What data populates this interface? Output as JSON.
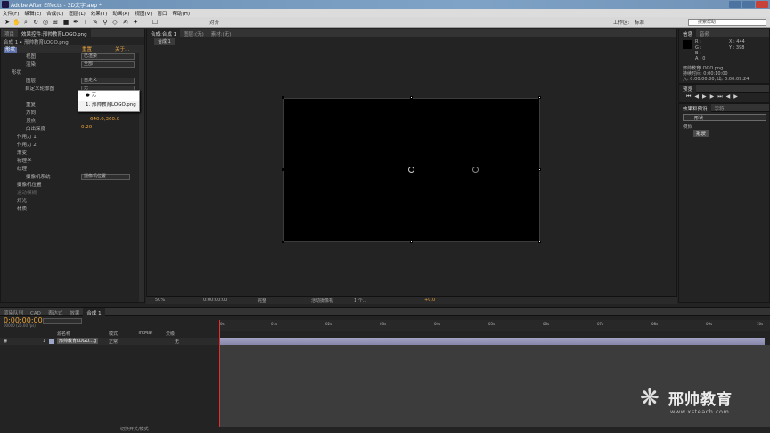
{
  "window": {
    "title": "Adobe After Effects - 3D文字.aep *"
  },
  "menu": [
    "文件(F)",
    "编辑(E)",
    "合成(C)",
    "图层(L)",
    "效果(T)",
    "动画(A)",
    "视图(V)",
    "窗口",
    "帮助(H)"
  ],
  "toolbar": {
    "align_label": "对齐",
    "workspace_label": "工作区:",
    "workspace_value": "标准",
    "search_placeholder": "搜索帮助"
  },
  "fx_panel": {
    "tab_project": "项目",
    "tab_fx": "效果控件:邢帅教育LOGO.png",
    "subtitle": "合成 1 • 邢帅教育LOGO.png",
    "effect_name": "形状",
    "reset_label": "重置",
    "about_label": "关于...",
    "view_label": "视图",
    "view_value": "已渲染",
    "render_label": "渲染",
    "render_value": "全部",
    "shape_group": "形状",
    "layer_label": "图层",
    "layer_value": "自定义",
    "custom_label": "自定义轮廓图",
    "custom_value": "无",
    "repeat_label": "重复",
    "direction_label": "方向",
    "vertex_label": "顶点",
    "vertex_value": "640.0,360.0",
    "bevel_label": "凸出深度",
    "bevel_value": "0.20",
    "groups": [
      "作用力 1",
      "作用力 2",
      "渐变",
      "物理学",
      "纹理"
    ],
    "camera_system_label": "摄像机系统",
    "camera_system_value": "摄像机位置",
    "camera_position": "摄像机位置",
    "motion_blur": "运动模糊",
    "lights": "灯光",
    "material": "材质",
    "popup": {
      "none": "无",
      "item": "1. 邢帅教育LOGO.png"
    }
  },
  "comp": {
    "tab": "合成:合成 1",
    "layer_tab": "图层:(无)",
    "footage_tab": "素材:(无)",
    "breadcrumb": "合成 1",
    "zoom": "50%",
    "timecode": "0:00:00:00",
    "quality": "完整",
    "camera": "活动摄像机",
    "views": "1 个...",
    "exposure": "+0.0"
  },
  "info": {
    "tab_info": "信息",
    "tab_audio": "音频",
    "r": "R :",
    "g": "G :",
    "b": "B :",
    "a": "A : 0",
    "x": "X : 444",
    "y": "Y : 398",
    "file": "邢帅教育LOGO.png",
    "duration": "持续时间: 0:00:10:00",
    "inout": "入: 0:00:00:00, 出: 0:00:09:24"
  },
  "preview": {
    "tab": "预览"
  },
  "effects": {
    "tab": "效果和预设",
    "tab2": "字符",
    "search": "形状",
    "category": "模拟",
    "item": "形状"
  },
  "timeline": {
    "tabs": [
      "渲染队列",
      "CAD",
      "表达式",
      "效果",
      "合成 1"
    ],
    "timecode": "0:00:00:00",
    "fps": "00000 (25.00 fps)",
    "col_name": "源名称",
    "col_mode": "模式",
    "col_trk": "T TrkMat",
    "col_parent": "父级",
    "layer_num": "1",
    "layer_name": "邢帅教育LOGO...g",
    "layer_mode": "正常",
    "layer_parent": "无",
    "ruler": [
      "0s",
      "01s",
      "02s",
      "03s",
      "04s",
      "05s",
      "06s",
      "07s",
      "08s",
      "09s",
      "10s"
    ],
    "footer": "切换开关/模式"
  },
  "watermark": {
    "brand": "邢帅教育",
    "url": "www.xsteach.com"
  }
}
